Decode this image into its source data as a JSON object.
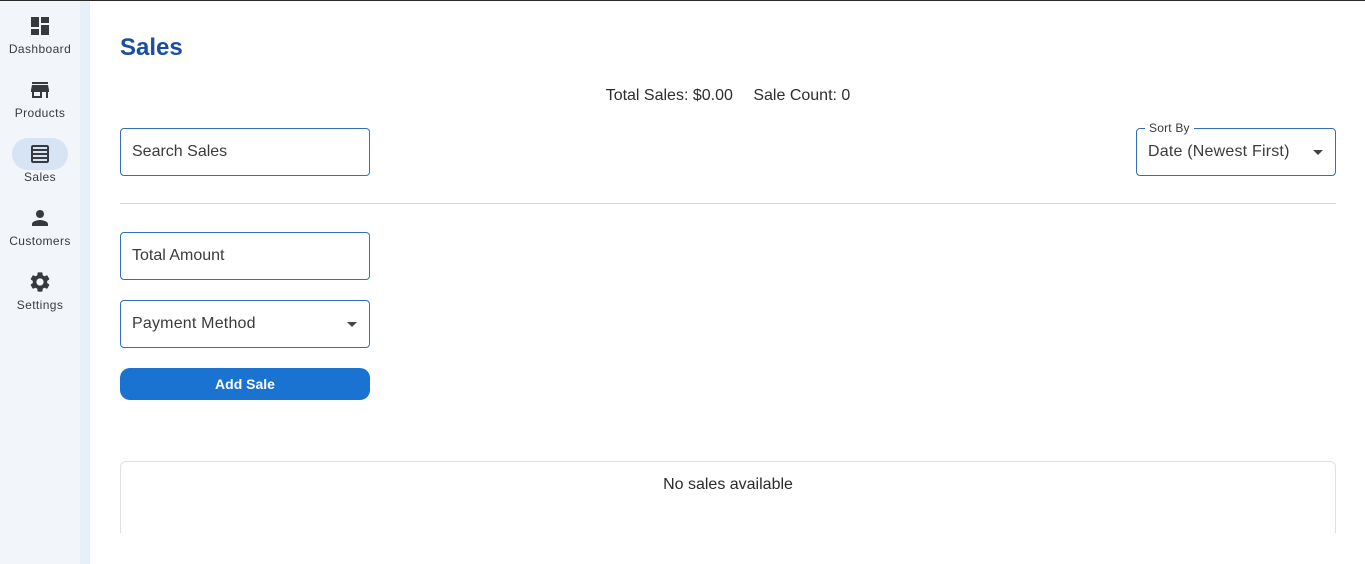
{
  "nav": {
    "items": [
      {
        "label": "Dashboard",
        "icon": "dashboard-icon"
      },
      {
        "label": "Products",
        "icon": "store-icon"
      },
      {
        "label": "Sales",
        "icon": "receipt-icon",
        "active": true
      },
      {
        "label": "Customers",
        "icon": "person-icon"
      },
      {
        "label": "Settings",
        "icon": "gear-icon"
      }
    ]
  },
  "page": {
    "title": "Sales"
  },
  "summary": {
    "total_sales": "Total Sales: $0.00",
    "sale_count": "Sale Count: 0"
  },
  "search": {
    "placeholder": "Search Sales"
  },
  "sort": {
    "label": "Sort By",
    "selected": "Date (Newest First)"
  },
  "form": {
    "total_amount_placeholder": "Total Amount",
    "payment_method_placeholder": "Payment Method",
    "add_button": "Add Sale"
  },
  "table": {
    "empty_message": "No sales available"
  },
  "colors": {
    "accent": "#1b73d1",
    "title": "#1a4ea1",
    "rail": "#f2f5fa",
    "active_pill": "#d7e4f5"
  }
}
